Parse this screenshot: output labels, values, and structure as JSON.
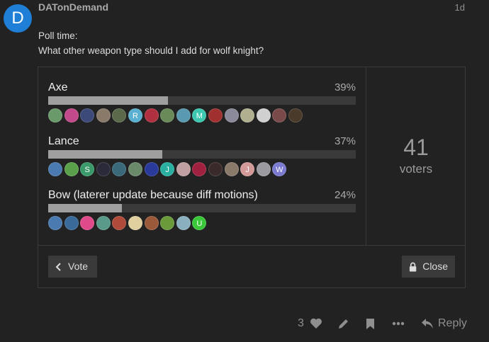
{
  "post": {
    "avatar_letter": "D",
    "username": "DATonDemand",
    "date": "1d",
    "line1": "Poll time:",
    "line2": "What other weapon type should I add for wolf knight?"
  },
  "poll": {
    "options": [
      {
        "name": "Axe",
        "percent_label": "39%",
        "percent": 39,
        "voters": [
          {
            "c": "#6a9a6a",
            "t": ""
          },
          {
            "c": "#c24a8a",
            "t": ""
          },
          {
            "c": "#3c4a7a",
            "t": ""
          },
          {
            "c": "#8a7a6a",
            "t": ""
          },
          {
            "c": "#5a6a4a",
            "t": ""
          },
          {
            "c": "#5ab0d0",
            "t": "R"
          },
          {
            "c": "#b03040",
            "t": ""
          },
          {
            "c": "#6a8a5a",
            "t": ""
          },
          {
            "c": "#5a9ab0",
            "t": ""
          },
          {
            "c": "#3cc8b0",
            "t": "M"
          },
          {
            "c": "#a03030",
            "t": ""
          },
          {
            "c": "#8a8a9a",
            "t": ""
          },
          {
            "c": "#b0b090",
            "t": ""
          },
          {
            "c": "#d0d0d0",
            "t": ""
          },
          {
            "c": "#7a4a4a",
            "t": ""
          },
          {
            "c": "#4a3a2a",
            "t": ""
          }
        ]
      },
      {
        "name": "Lance",
        "percent_label": "37%",
        "percent": 37,
        "voters": [
          {
            "c": "#4a7ab0",
            "t": ""
          },
          {
            "c": "#5aa04a",
            "t": ""
          },
          {
            "c": "#3a9a6a",
            "t": "S"
          },
          {
            "c": "#2a2a3a",
            "t": ""
          },
          {
            "c": "#3a6a7a",
            "t": ""
          },
          {
            "c": "#6a8a6a",
            "t": ""
          },
          {
            "c": "#2a3a9a",
            "t": ""
          },
          {
            "c": "#2ab0a0",
            "t": "J"
          },
          {
            "c": "#c0a0a0",
            "t": ""
          },
          {
            "c": "#a02040",
            "t": ""
          },
          {
            "c": "#3a2a2a",
            "t": ""
          },
          {
            "c": "#8a7a6a",
            "t": ""
          },
          {
            "c": "#d49a9a",
            "t": "J"
          },
          {
            "c": "#9a9aa0",
            "t": ""
          },
          {
            "c": "#7a7ad0",
            "t": "W"
          }
        ]
      },
      {
        "name": "Bow (laterer update because diff motions)",
        "percent_label": "24%",
        "percent": 24,
        "voters": [
          {
            "c": "#4a7ab0",
            "t": ""
          },
          {
            "c": "#3a6a9a",
            "t": ""
          },
          {
            "c": "#e04a8a",
            "t": ""
          },
          {
            "c": "#5a9a8a",
            "t": ""
          },
          {
            "c": "#b04a3a",
            "t": ""
          },
          {
            "c": "#e0d0a0",
            "t": ""
          },
          {
            "c": "#9a5a3a",
            "t": ""
          },
          {
            "c": "#6a9a3a",
            "t": ""
          },
          {
            "c": "#8ab0c0",
            "t": ""
          },
          {
            "c": "#3ac83a",
            "t": "U"
          }
        ]
      }
    ],
    "voters_count": "41",
    "voters_label": "voters",
    "vote_label": "Vote",
    "close_label": "Close"
  },
  "actions": {
    "like_count": "3",
    "reply_label": "Reply"
  },
  "icons": [
    "chevron-left-icon",
    "lock-icon",
    "heart-icon",
    "pencil-icon",
    "bookmark-icon",
    "ellipsis-icon",
    "reply-icon"
  ],
  "colors": {
    "avatar": "#1f7fd6",
    "background": "#222222",
    "bar_fill": "#9f9f9f",
    "bar_track": "#3a3a3a"
  }
}
